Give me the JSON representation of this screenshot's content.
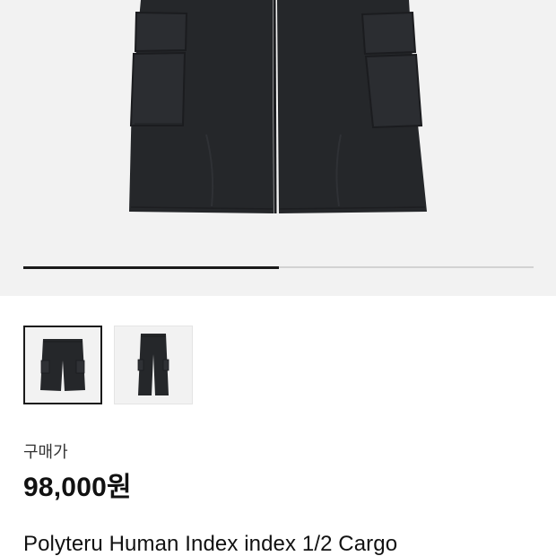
{
  "gallery": {
    "current_index": 1,
    "total_images": 2,
    "progress_fraction": 0.5,
    "thumbnails": [
      {
        "name": "thumbnail-1",
        "selected": true
      },
      {
        "name": "thumbnail-2",
        "selected": false
      }
    ]
  },
  "product": {
    "price_label": "구매가",
    "price": "98,000원",
    "title": "Polyteru Human Index index 1/2 Cargo"
  },
  "colors": {
    "hero_background": "#f2f2f2",
    "garment": "#25272a",
    "progress_active": "#1a1a1a",
    "progress_track": "#d2d2d2",
    "selected_border": "#1a1a1a"
  }
}
